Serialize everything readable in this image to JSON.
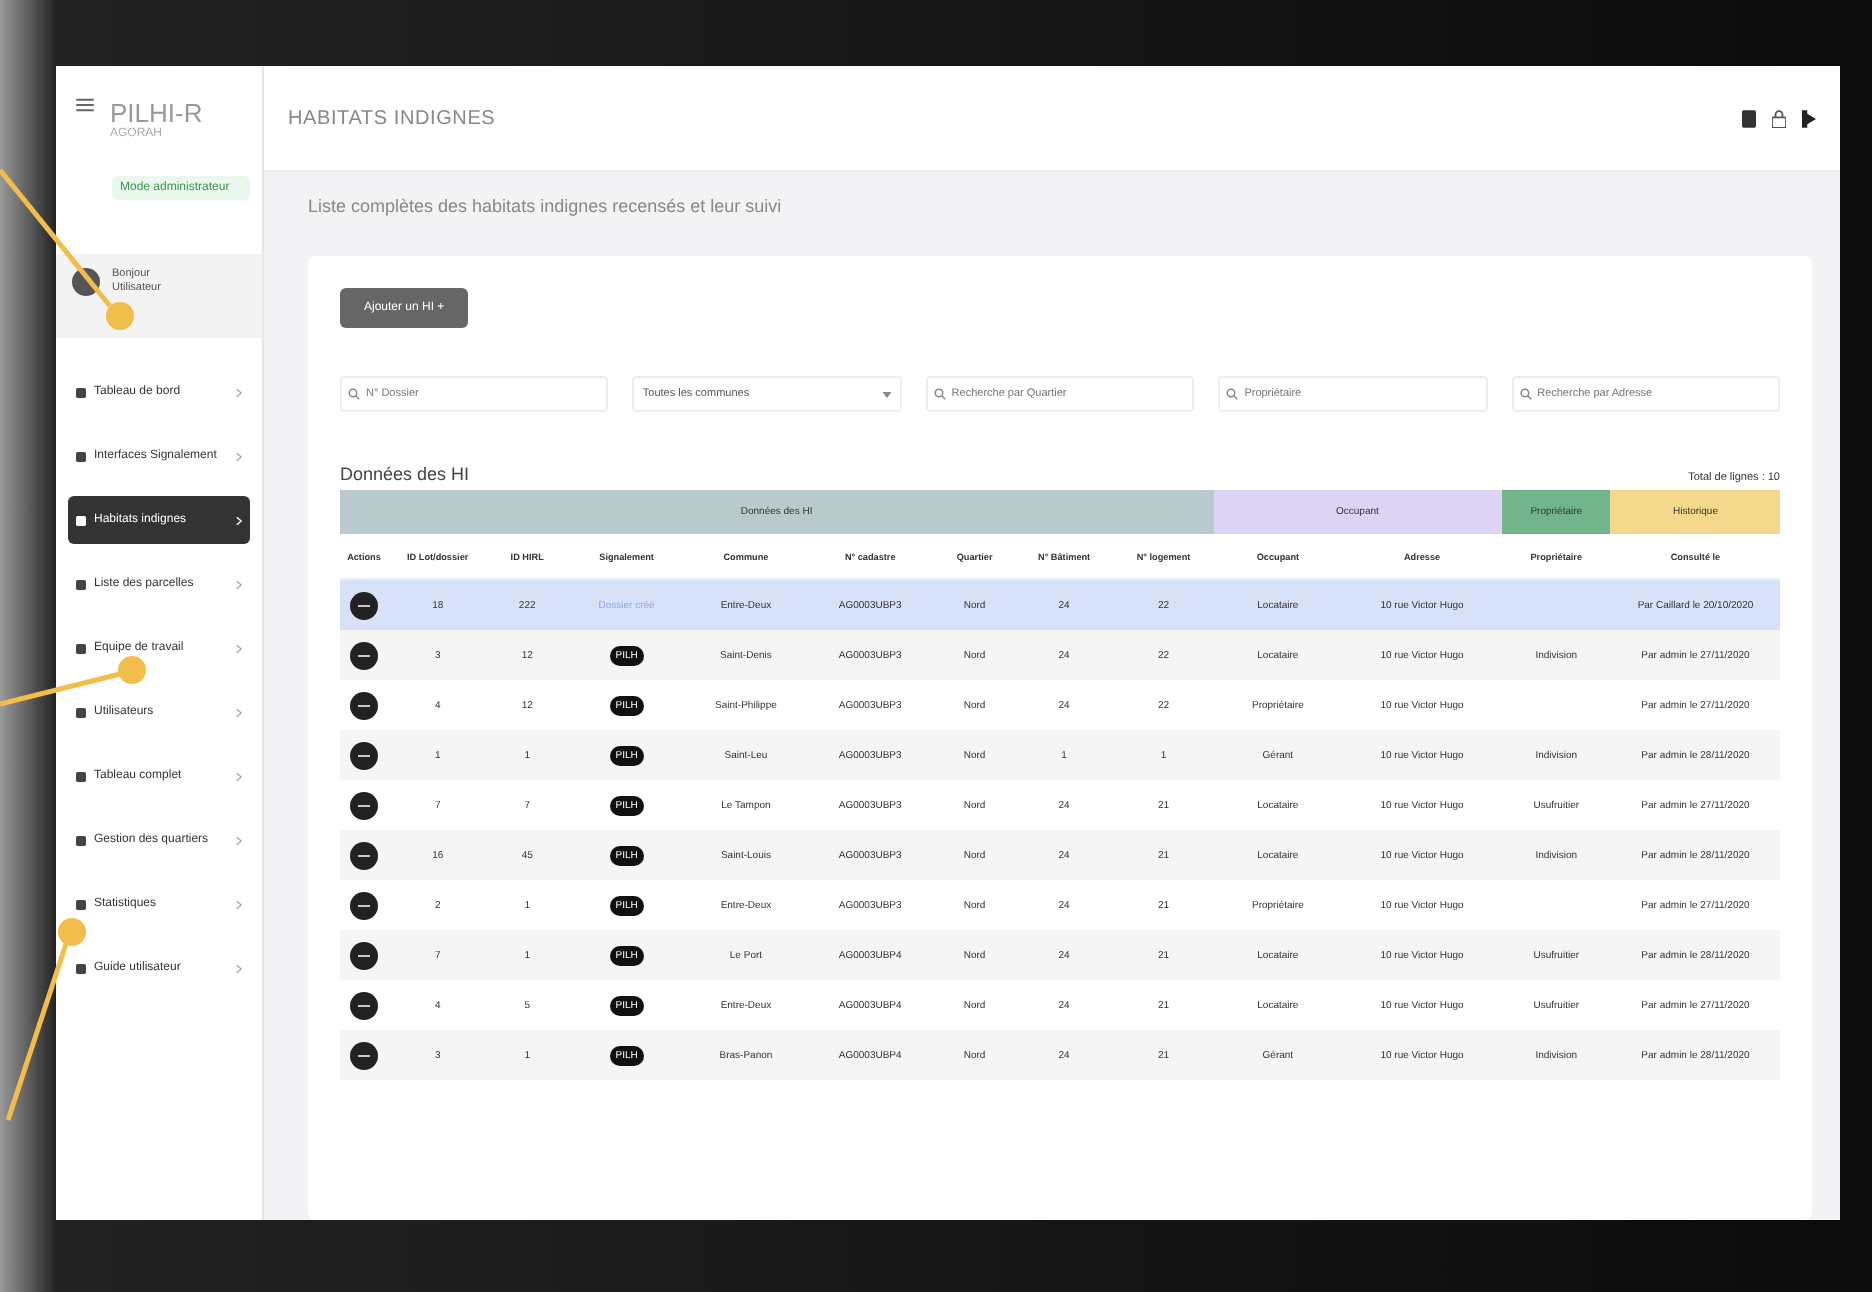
{
  "sidebar": {
    "app_name": "PILHI-R",
    "org": "AGORAH",
    "mode_badge": "Mode administrateur",
    "user": {
      "greeting": "Bonjour",
      "name": "Utilisateur"
    },
    "items": [
      {
        "label": "Tableau de bord",
        "selected": false
      },
      {
        "label": "Interfaces Signalement",
        "selected": false
      },
      {
        "label": "Habitats indignes",
        "selected": true
      },
      {
        "label": "Liste des parcelles",
        "selected": false
      },
      {
        "label": "Equipe de travail",
        "selected": false
      },
      {
        "label": "Utilisateurs",
        "selected": false
      },
      {
        "label": "Tableau complet",
        "selected": false
      },
      {
        "label": "Gestion des quartiers",
        "selected": false
      },
      {
        "label": "Statistiques",
        "selected": false
      },
      {
        "label": "Guide utilisateur",
        "selected": false
      }
    ]
  },
  "header": {
    "title": "HABITATS INDIGNES"
  },
  "subtitle": "Liste complètes des habitats indignes recensés et leur suivi",
  "add_button": "Ajouter un HI +",
  "filters": [
    {
      "kind": "search",
      "placeholder": "N° Dossier"
    },
    {
      "kind": "select",
      "value": "Toutes les communes"
    },
    {
      "kind": "search",
      "placeholder": "Recherche par Quartier"
    },
    {
      "kind": "search",
      "placeholder": "Propriétaire"
    },
    {
      "kind": "search",
      "placeholder": "Recherche par Adresse"
    }
  ],
  "table": {
    "title": "Données des HI",
    "total": "Total de lignes : 10",
    "groups": [
      {
        "label": "Données des HI",
        "color": "#b9cacd",
        "columns": [
          "Actions",
          "ID Lot/dossier",
          "ID HIRL",
          "Signalement",
          "Commune",
          "N° cadastre",
          "Quartier",
          "N° Bâtiment",
          "N° logement"
        ]
      },
      {
        "label": "Occupant",
        "color": "#ddd3f3",
        "columns": [
          "Occupant",
          "Adresse"
        ]
      },
      {
        "label": "Propriétaire",
        "color": "#72b58c",
        "columns": [
          "Propriétaire"
        ]
      },
      {
        "label": "Historique",
        "color": "#f4d98c",
        "columns": [
          "Consulté le"
        ]
      }
    ],
    "rows": [
      {
        "selected": true,
        "cells": [
          "18",
          "222",
          {
            "kind": "link",
            "text": "Dossier créé"
          },
          "Entre-Deux",
          "AG0003UBP3",
          "Nord",
          "24",
          "22",
          "Locataire",
          "10 rue Victor Hugo",
          "",
          "Par Caillard le 20/10/2020"
        ]
      },
      {
        "selected": false,
        "cells": [
          "3",
          "12",
          {
            "kind": "badge",
            "text": "PILH"
          },
          "Saint-Denis",
          "AG0003UBP3",
          "Nord",
          "24",
          "22",
          "Locataire",
          "10 rue Victor Hugo",
          "Indivision",
          "Par admin le 27/11/2020"
        ]
      },
      {
        "selected": false,
        "cells": [
          "4",
          "12",
          {
            "kind": "badge",
            "text": "PILH"
          },
          "Saint-Philippe",
          "AG0003UBP3",
          "Nord",
          "24",
          "22",
          "Propriétaire",
          "10 rue Victor Hugo",
          "",
          "Par admin le 27/11/2020"
        ]
      },
      {
        "selected": false,
        "cells": [
          "1",
          "1",
          {
            "kind": "badge",
            "text": "PILH"
          },
          "Saint-Leu",
          "AG0003UBP3",
          "Nord",
          "1",
          "1",
          "Gérant",
          "10 rue Victor Hugo",
          "Indivision",
          "Par admin le 28/11/2020"
        ]
      },
      {
        "selected": false,
        "cells": [
          "7",
          "7",
          {
            "kind": "badge",
            "text": "PILH"
          },
          "Le Tampon",
          "AG0003UBP3",
          "Nord",
          "24",
          "21",
          "Locataire",
          "10 rue Victor Hugo",
          "Usufruitier",
          "Par admin le 27/11/2020"
        ]
      },
      {
        "selected": false,
        "cells": [
          "16",
          "45",
          {
            "kind": "badge",
            "text": "PILH"
          },
          "Saint-Louis",
          "AG0003UBP3",
          "Nord",
          "24",
          "21",
          "Locataire",
          "10 rue Victor Hugo",
          "Indivision",
          "Par admin le 28/11/2020"
        ]
      },
      {
        "selected": false,
        "cells": [
          "2",
          "1",
          {
            "kind": "badge",
            "text": "PILH"
          },
          "Entre-Deux",
          "AG0003UBP3",
          "Nord",
          "24",
          "21",
          "Propriétaire",
          "10 rue Victor Hugo",
          "",
          "Par admin le 27/11/2020"
        ]
      },
      {
        "selected": false,
        "cells": [
          "7",
          "1",
          {
            "kind": "badge",
            "text": "PILH"
          },
          "Le Port",
          "AG0003UBP4",
          "Nord",
          "24",
          "21",
          "Locataire",
          "10 rue Victor Hugo",
          "Usufruitier",
          "Par admin le 28/11/2020"
        ]
      },
      {
        "selected": false,
        "cells": [
          "4",
          "5",
          {
            "kind": "badge",
            "text": "PILH"
          },
          "Entre-Deux",
          "AG0003UBP4",
          "Nord",
          "24",
          "21",
          "Locataire",
          "10 rue Victor Hugo",
          "Usufruitier",
          "Par admin le 27/11/2020"
        ]
      },
      {
        "selected": false,
        "cells": [
          "3",
          "1",
          {
            "kind": "badge",
            "text": "PILH"
          },
          "Bras-Panon",
          "AG0003UBP4",
          "Nord",
          "24",
          "21",
          "Gérant",
          "10 rue Victor Hugo",
          "Indivision",
          "Par admin le 28/11/2020"
        ]
      }
    ]
  }
}
